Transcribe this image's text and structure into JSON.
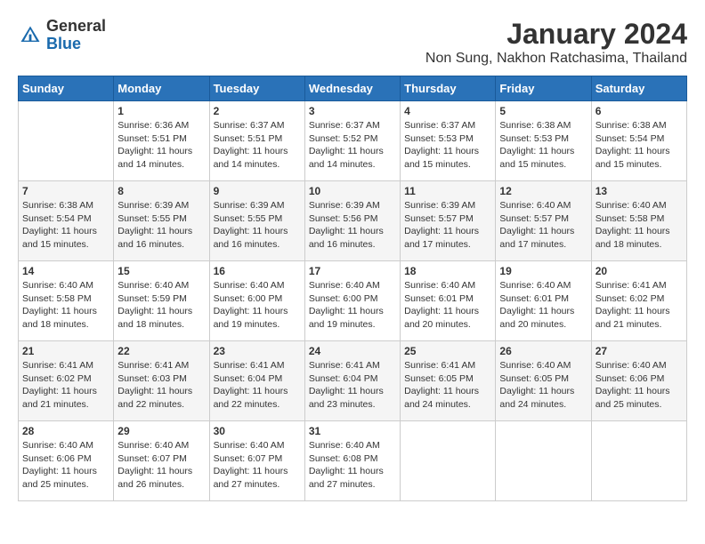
{
  "header": {
    "logo": {
      "general": "General",
      "blue": "Blue"
    },
    "title": "January 2024",
    "subtitle": "Non Sung, Nakhon Ratchasima, Thailand"
  },
  "calendar": {
    "days_of_week": [
      "Sunday",
      "Monday",
      "Tuesday",
      "Wednesday",
      "Thursday",
      "Friday",
      "Saturday"
    ],
    "weeks": [
      [
        {
          "day": "",
          "info": ""
        },
        {
          "day": "1",
          "info": "Sunrise: 6:36 AM\nSunset: 5:51 PM\nDaylight: 11 hours and 14 minutes."
        },
        {
          "day": "2",
          "info": "Sunrise: 6:37 AM\nSunset: 5:51 PM\nDaylight: 11 hours and 14 minutes."
        },
        {
          "day": "3",
          "info": "Sunrise: 6:37 AM\nSunset: 5:52 PM\nDaylight: 11 hours and 14 minutes."
        },
        {
          "day": "4",
          "info": "Sunrise: 6:37 AM\nSunset: 5:53 PM\nDaylight: 11 hours and 15 minutes."
        },
        {
          "day": "5",
          "info": "Sunrise: 6:38 AM\nSunset: 5:53 PM\nDaylight: 11 hours and 15 minutes."
        },
        {
          "day": "6",
          "info": "Sunrise: 6:38 AM\nSunset: 5:54 PM\nDaylight: 11 hours and 15 minutes."
        }
      ],
      [
        {
          "day": "7",
          "info": "Sunrise: 6:38 AM\nSunset: 5:54 PM\nDaylight: 11 hours and 15 minutes."
        },
        {
          "day": "8",
          "info": "Sunrise: 6:39 AM\nSunset: 5:55 PM\nDaylight: 11 hours and 16 minutes."
        },
        {
          "day": "9",
          "info": "Sunrise: 6:39 AM\nSunset: 5:55 PM\nDaylight: 11 hours and 16 minutes."
        },
        {
          "day": "10",
          "info": "Sunrise: 6:39 AM\nSunset: 5:56 PM\nDaylight: 11 hours and 16 minutes."
        },
        {
          "day": "11",
          "info": "Sunrise: 6:39 AM\nSunset: 5:57 PM\nDaylight: 11 hours and 17 minutes."
        },
        {
          "day": "12",
          "info": "Sunrise: 6:40 AM\nSunset: 5:57 PM\nDaylight: 11 hours and 17 minutes."
        },
        {
          "day": "13",
          "info": "Sunrise: 6:40 AM\nSunset: 5:58 PM\nDaylight: 11 hours and 18 minutes."
        }
      ],
      [
        {
          "day": "14",
          "info": "Sunrise: 6:40 AM\nSunset: 5:58 PM\nDaylight: 11 hours and 18 minutes."
        },
        {
          "day": "15",
          "info": "Sunrise: 6:40 AM\nSunset: 5:59 PM\nDaylight: 11 hours and 18 minutes."
        },
        {
          "day": "16",
          "info": "Sunrise: 6:40 AM\nSunset: 6:00 PM\nDaylight: 11 hours and 19 minutes."
        },
        {
          "day": "17",
          "info": "Sunrise: 6:40 AM\nSunset: 6:00 PM\nDaylight: 11 hours and 19 minutes."
        },
        {
          "day": "18",
          "info": "Sunrise: 6:40 AM\nSunset: 6:01 PM\nDaylight: 11 hours and 20 minutes."
        },
        {
          "day": "19",
          "info": "Sunrise: 6:40 AM\nSunset: 6:01 PM\nDaylight: 11 hours and 20 minutes."
        },
        {
          "day": "20",
          "info": "Sunrise: 6:41 AM\nSunset: 6:02 PM\nDaylight: 11 hours and 21 minutes."
        }
      ],
      [
        {
          "day": "21",
          "info": "Sunrise: 6:41 AM\nSunset: 6:02 PM\nDaylight: 11 hours and 21 minutes."
        },
        {
          "day": "22",
          "info": "Sunrise: 6:41 AM\nSunset: 6:03 PM\nDaylight: 11 hours and 22 minutes."
        },
        {
          "day": "23",
          "info": "Sunrise: 6:41 AM\nSunset: 6:04 PM\nDaylight: 11 hours and 22 minutes."
        },
        {
          "day": "24",
          "info": "Sunrise: 6:41 AM\nSunset: 6:04 PM\nDaylight: 11 hours and 23 minutes."
        },
        {
          "day": "25",
          "info": "Sunrise: 6:41 AM\nSunset: 6:05 PM\nDaylight: 11 hours and 24 minutes."
        },
        {
          "day": "26",
          "info": "Sunrise: 6:40 AM\nSunset: 6:05 PM\nDaylight: 11 hours and 24 minutes."
        },
        {
          "day": "27",
          "info": "Sunrise: 6:40 AM\nSunset: 6:06 PM\nDaylight: 11 hours and 25 minutes."
        }
      ],
      [
        {
          "day": "28",
          "info": "Sunrise: 6:40 AM\nSunset: 6:06 PM\nDaylight: 11 hours and 25 minutes."
        },
        {
          "day": "29",
          "info": "Sunrise: 6:40 AM\nSunset: 6:07 PM\nDaylight: 11 hours and 26 minutes."
        },
        {
          "day": "30",
          "info": "Sunrise: 6:40 AM\nSunset: 6:07 PM\nDaylight: 11 hours and 27 minutes."
        },
        {
          "day": "31",
          "info": "Sunrise: 6:40 AM\nSunset: 6:08 PM\nDaylight: 11 hours and 27 minutes."
        },
        {
          "day": "",
          "info": ""
        },
        {
          "day": "",
          "info": ""
        },
        {
          "day": "",
          "info": ""
        }
      ]
    ]
  }
}
